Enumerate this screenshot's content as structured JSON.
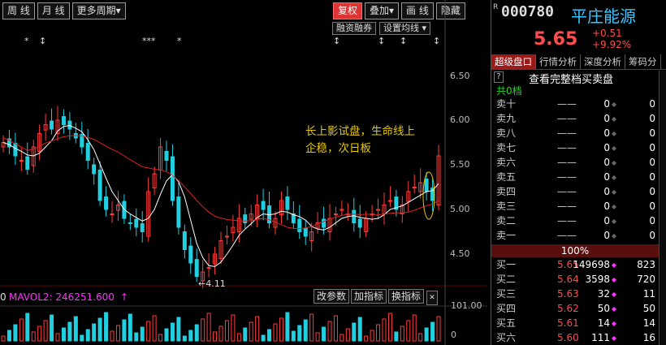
{
  "toolbar": {
    "left": [
      "周 线",
      "月 线",
      "更多周期▾"
    ],
    "right": [
      "复权",
      "叠加▾",
      "画 线",
      "隐藏"
    ]
  },
  "sub_buttons": [
    "融资融券",
    "设置均线 ▾"
  ],
  "axis": {
    "labels": [
      "6.50",
      "6.00",
      "5.50",
      "5.00",
      "4.50"
    ],
    "vol_max": "101.00",
    "vol_mid": "0"
  },
  "annotation": {
    "line1": "长上影试盘，生命线上",
    "line2": "企稳，次日板",
    "low_label": "4.11"
  },
  "markers": {
    "m1": "*",
    "m2": "↕",
    "m3": "***",
    "m4": "*",
    "m5": "↕",
    "m6": "↕",
    "m7": "↕",
    "m8": "↕"
  },
  "vol_bar": {
    "mavol2": "MAVOL2: 246251.600",
    "arrow": "↑",
    "left_text": "0",
    "buttons": [
      "改参数",
      "加指标",
      "换指标"
    ]
  },
  "stock": {
    "symbol": "R",
    "code": "000780",
    "name": "平庄能源",
    "price": "5.65",
    "change": "+0.51",
    "change_pct": "+9.92%"
  },
  "tabs": [
    "超级盘口",
    "行情分析",
    "深度分析",
    "筹码分"
  ],
  "orderbook": {
    "title": "查看完整档买卖盘",
    "q": "?",
    "total": "共0档",
    "sells": [
      {
        "label": "卖十",
        "price": "——",
        "vol": "0",
        "cnt": "0"
      },
      {
        "label": "卖九",
        "price": "——",
        "vol": "0",
        "cnt": "0"
      },
      {
        "label": "卖八",
        "price": "——",
        "vol": "0",
        "cnt": "0"
      },
      {
        "label": "卖七",
        "price": "——",
        "vol": "0",
        "cnt": "0"
      },
      {
        "label": "卖六",
        "price": "——",
        "vol": "0",
        "cnt": "0"
      },
      {
        "label": "卖五",
        "price": "——",
        "vol": "0",
        "cnt": "0"
      },
      {
        "label": "卖四",
        "price": "——",
        "vol": "0",
        "cnt": "0"
      },
      {
        "label": "卖三",
        "price": "——",
        "vol": "0",
        "cnt": "0"
      },
      {
        "label": "卖二",
        "price": "——",
        "vol": "0",
        "cnt": "0"
      },
      {
        "label": "卖一",
        "price": "——",
        "vol": "0",
        "cnt": "0"
      }
    ],
    "ratio": "100%",
    "buys": [
      {
        "label": "买一",
        "price": "5.65",
        "vol": "149698",
        "cnt": "823"
      },
      {
        "label": "买二",
        "price": "5.64",
        "vol": "3598",
        "cnt": "720"
      },
      {
        "label": "买三",
        "price": "5.63",
        "vol": "32",
        "cnt": "11"
      },
      {
        "label": "买四",
        "price": "5.62",
        "vol": "50",
        "cnt": "50"
      },
      {
        "label": "买五",
        "price": "5.61",
        "vol": "14",
        "cnt": "14"
      },
      {
        "label": "买六",
        "price": "5.60",
        "vol": "111",
        "cnt": "16"
      }
    ]
  },
  "colors": {
    "up": "#ff3b3b",
    "down": "#20d0e0",
    "ma_white": "#ffffff",
    "ma_red": "#e02020",
    "accent": "#3cc6ff"
  }
}
